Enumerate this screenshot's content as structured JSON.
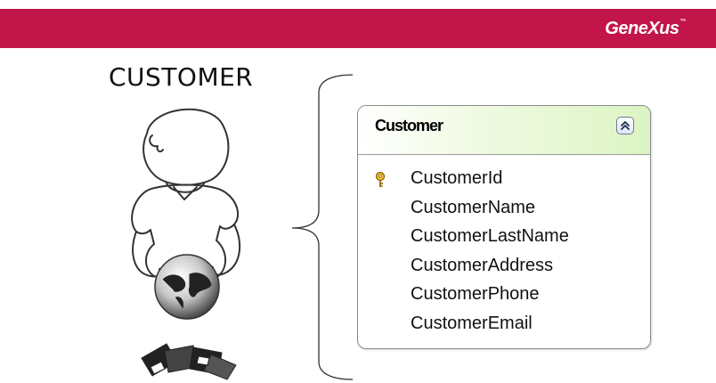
{
  "header": {
    "brand": "GeneXus",
    "brand_tm": "™",
    "bar_color": "#c2154a"
  },
  "entity_label": "CUSTOMER",
  "transaction": {
    "name": "Customer",
    "collapse_icon": "double-chevron-up-icon",
    "header_color": "#dcf4c2",
    "attributes": [
      {
        "name": "CustomerId",
        "key": true,
        "icon": "key-icon"
      },
      {
        "name": "CustomerName",
        "key": false
      },
      {
        "name": "CustomerLastName",
        "key": false
      },
      {
        "name": "CustomerAddress",
        "key": false
      },
      {
        "name": "CustomerPhone",
        "key": false
      },
      {
        "name": "CustomerEmail",
        "key": false
      }
    ]
  }
}
